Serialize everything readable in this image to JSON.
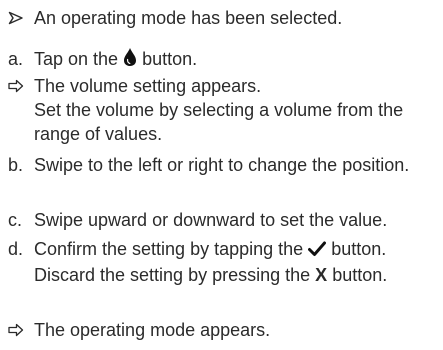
{
  "prerequisite": {
    "text": "An operating mode has been selected."
  },
  "steps": [
    {
      "label": "a.",
      "text_before": "Tap on the",
      "icon": "drop-icon",
      "text_after": "button."
    },
    {
      "label": "b.",
      "text": "Swipe to the left or right to change the position."
    },
    {
      "label": "c.",
      "text": "Swipe upward or downward to set the value."
    },
    {
      "label": "d.",
      "text_before": "Confirm the setting by tapping the",
      "icon": "checkmark-icon",
      "text_mid": "button. Discard the setting by pressing the",
      "bold": "X",
      "text_after": "button."
    }
  ],
  "result_a": {
    "line1": "The volume setting appears.",
    "line2": "Set the volume by selecting a volume from the range of values."
  },
  "final_result": {
    "text": "The operating mode appears."
  }
}
